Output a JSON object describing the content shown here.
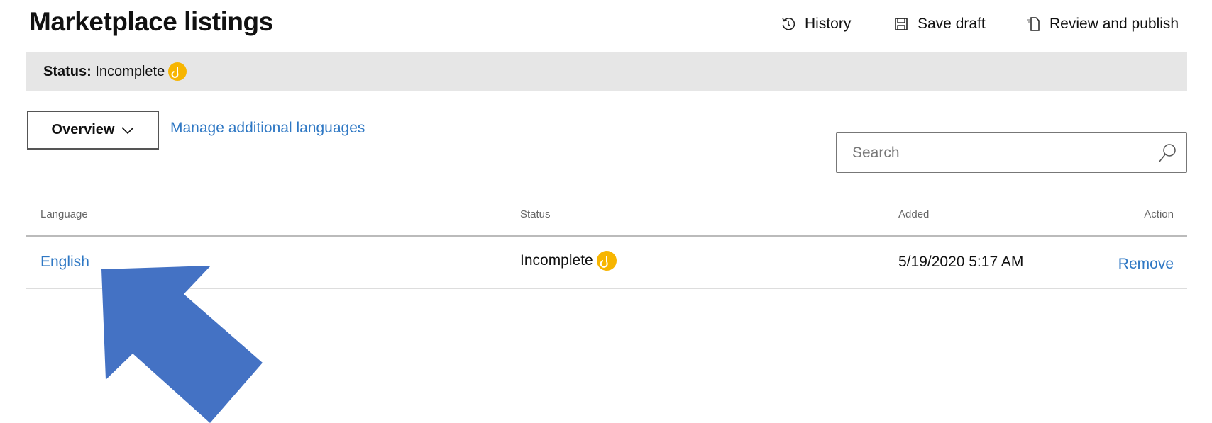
{
  "header": {
    "title": "Marketplace listings",
    "commands": [
      {
        "label": "History",
        "icon": "history-icon"
      },
      {
        "label": "Save draft",
        "icon": "save-icon"
      },
      {
        "label": "Review and publish",
        "icon": "document-icon"
      }
    ]
  },
  "status_bar": {
    "label": "Status:",
    "value": "Incomplete",
    "icon": "pending-icon",
    "color": "#f7b500"
  },
  "toolbar": {
    "overview_label": "Overview",
    "manage_label": "Manage additional languages",
    "search_placeholder": "Search"
  },
  "table": {
    "columns": [
      "Language",
      "Status",
      "Added",
      "Action"
    ],
    "rows": [
      {
        "language": "English",
        "status": "Incomplete",
        "added": "5/19/2020 5:17 AM",
        "action": "Remove"
      }
    ]
  },
  "annotation": {
    "arrow_color": "#4472c4"
  }
}
